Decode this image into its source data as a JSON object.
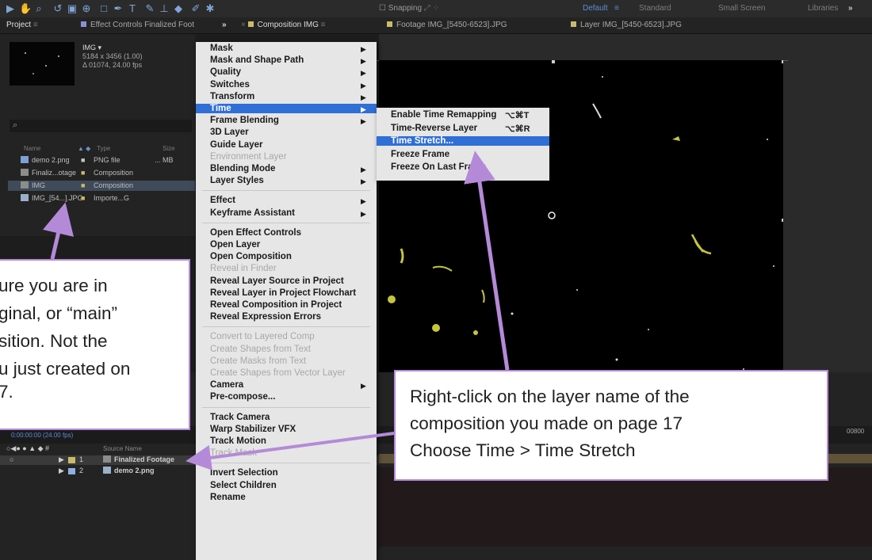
{
  "toolbar": {
    "snapping_label": "Snapping",
    "workspaces": [
      "Default",
      "Standard",
      "Small Screen",
      "Libraries"
    ],
    "more": "»"
  },
  "tabs": {
    "project": "Project",
    "effect_controls": "Effect Controls Finalized Foot",
    "overflow": "»",
    "composition": "Composition IMG",
    "footage": "Footage IMG_[5450-6523].JPG",
    "layer": "Layer IMG_[5450-6523].JPG"
  },
  "project": {
    "item_name": "IMG ▾",
    "dimensions": "5184 x 3456 (1.00)",
    "duration": "Δ 01074, 24.00 fps",
    "search_glyph": "⌕",
    "columns": {
      "name": "Name",
      "type": "Type",
      "size": "Size"
    },
    "rows": [
      {
        "name": "demo 2.png",
        "type": "PNG file",
        "size": "... MB",
        "selected": false
      },
      {
        "name": "Finaliz...otage",
        "type": "Composition",
        "size": "",
        "selected": false
      },
      {
        "name": "IMG",
        "type": "Composition",
        "size": "",
        "selected": true
      },
      {
        "name": "IMG_[54...].JPG",
        "type": "Importe...G",
        "size": "",
        "selected": false
      }
    ]
  },
  "timeline": {
    "timecode": "0:00:00:00 (24.00 fps)",
    "ruler_end": "00800",
    "col_source": "Source Name",
    "layers": [
      {
        "num": "1",
        "name": "Finalized Footage",
        "selected": true
      },
      {
        "num": "2",
        "name": "demo 2.png",
        "selected": false
      }
    ],
    "viewer_timecode": "00"
  },
  "context_menu": {
    "items": [
      {
        "label": "Mask",
        "submenu": true
      },
      {
        "label": "Mask and Shape Path",
        "submenu": true
      },
      {
        "label": "Quality",
        "submenu": true
      },
      {
        "label": "Switches",
        "submenu": true
      },
      {
        "label": "Transform",
        "submenu": true
      },
      {
        "label": "Time",
        "submenu": true,
        "highlighted": true
      },
      {
        "label": "Frame Blending",
        "submenu": true
      },
      {
        "label": "3D Layer"
      },
      {
        "label": "Guide Layer"
      },
      {
        "label": "Environment Layer",
        "disabled": true
      },
      {
        "label": "Blending Mode",
        "submenu": true
      },
      {
        "label": "Layer Styles",
        "submenu": true
      },
      {
        "label": "Effect",
        "submenu": true
      },
      {
        "label": "Keyframe Assistant",
        "submenu": true
      },
      {
        "label": "Open Effect Controls"
      },
      {
        "label": "Open Layer"
      },
      {
        "label": "Open Composition"
      },
      {
        "label": "Reveal in Finder",
        "disabled": true
      },
      {
        "label": "Reveal Layer Source in Project"
      },
      {
        "label": "Reveal Layer in Project Flowchart"
      },
      {
        "label": "Reveal Composition in Project"
      },
      {
        "label": "Reveal Expression Errors"
      },
      {
        "label": "Convert to Layered Comp",
        "disabled": true
      },
      {
        "label": "Create Shapes from Text",
        "disabled": true
      },
      {
        "label": "Create Masks from Text",
        "disabled": true
      },
      {
        "label": "Create Shapes from Vector Layer",
        "disabled": true
      },
      {
        "label": "Camera",
        "submenu": true
      },
      {
        "label": "Pre-compose..."
      },
      {
        "label": "Track Camera"
      },
      {
        "label": "Warp Stabilizer VFX"
      },
      {
        "label": "Track Motion"
      },
      {
        "label": "Track Mask",
        "disabled": true
      },
      {
        "label": "Invert Selection"
      },
      {
        "label": "Select Children"
      },
      {
        "label": "Rename"
      }
    ]
  },
  "time_submenu": {
    "items": [
      {
        "label": "Enable Time Remapping",
        "shortcut": "⌥⌘T"
      },
      {
        "label": "Time-Reverse Layer",
        "shortcut": "⌥⌘R"
      },
      {
        "label": "Time Stretch...",
        "highlighted": true
      },
      {
        "label": "Freeze Frame"
      },
      {
        "label": "Freeze On Last Frame"
      }
    ]
  },
  "callout_left": {
    "lines": [
      "ure you are in",
      "ginal, or “main”",
      "sition. Not the",
      "u just created on",
      "7."
    ]
  },
  "callout_right": {
    "lines": [
      "Right-click on the layer name of the",
      "composition you made on page 17",
      "Choose Time > Time Stretch"
    ]
  },
  "colors": {
    "menu_bg": "#e6e6e6",
    "menu_highlight": "#2f6fd6",
    "annotation": "#b48ad8",
    "footage_accent": "#c6c63a"
  },
  "icons": [
    "select-tool-icon",
    "hand-tool-icon",
    "zoom-tool-icon",
    "rotate-tool-icon",
    "camera-tool-icon",
    "pen-tool-icon",
    "text-tool-icon",
    "brush-tool-icon",
    "stamp-tool-icon",
    "eraser-tool-icon",
    "roto-tool-icon",
    "puppet-tool-icon",
    "search-icon",
    "submenu-arrow-icon"
  ]
}
